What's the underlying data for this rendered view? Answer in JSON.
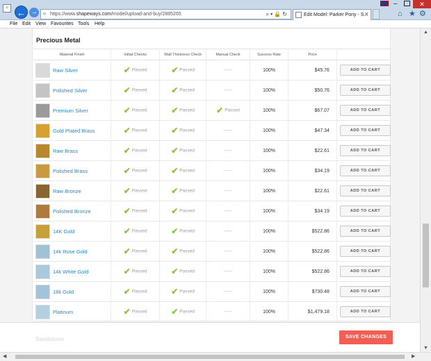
{
  "browser": {
    "url_prefix": "https://www.",
    "url_domain": "shapeways.com",
    "url_path": "/model/upload-and-buy/2885265",
    "tab_title": "Edit Model: Parker Pony - S...",
    "menu": [
      "File",
      "Edit",
      "View",
      "Favourites",
      "Tools",
      "Help"
    ]
  },
  "section": {
    "title": "Precious Metal",
    "columns": [
      "Material Finish",
      "Initial Checks",
      "Wall Thickness Check",
      "Manual Check",
      "Success Rate",
      "Price",
      ""
    ]
  },
  "rows": [
    {
      "name": "Raw Silver",
      "thumb_color": "#d9d9d9",
      "initial": "Passed",
      "wall": "Passed",
      "manual": "-----",
      "manual_passed": false,
      "rate": "100%",
      "price": "$45.76",
      "button": "ADD TO CART"
    },
    {
      "name": "Polished Silver",
      "thumb_color": "#c4c4c4",
      "initial": "Passed",
      "wall": "Passed",
      "manual": "-----",
      "manual_passed": false,
      "rate": "100%",
      "price": "$50.76",
      "button": "ADD TO CART"
    },
    {
      "name": "Premium Silver",
      "thumb_color": "#9a9a9a",
      "initial": "Passed",
      "wall": "Passed",
      "manual": "Passed",
      "manual_passed": true,
      "rate": "100%",
      "price": "$67.07",
      "button": "ADD TO CART"
    },
    {
      "name": "Gold Plated Brass",
      "thumb_color": "#d6a12e",
      "initial": "Passed",
      "wall": "Passed",
      "manual": "-----",
      "manual_passed": false,
      "rate": "100%",
      "price": "$47.34",
      "button": "ADD TO CART"
    },
    {
      "name": "Raw Brass",
      "thumb_color": "#b8892c",
      "initial": "Passed",
      "wall": "Passed",
      "manual": "-----",
      "manual_passed": false,
      "rate": "100%",
      "price": "$22.61",
      "button": "ADD TO CART"
    },
    {
      "name": "Polished Brass",
      "thumb_color": "#c99a3f",
      "initial": "Passed",
      "wall": "Passed",
      "manual": "-----",
      "manual_passed": false,
      "rate": "100%",
      "price": "$34.19",
      "button": "ADD TO CART"
    },
    {
      "name": "Raw Bronze",
      "thumb_color": "#8a6530",
      "initial": "Passed",
      "wall": "Passed",
      "manual": "-----",
      "manual_passed": false,
      "rate": "100%",
      "price": "$22.61",
      "button": "ADD TO CART"
    },
    {
      "name": "Polished Bronze",
      "thumb_color": "#b07a3a",
      "initial": "Passed",
      "wall": "Passed",
      "manual": "-----",
      "manual_passed": false,
      "rate": "100%",
      "price": "$34.19",
      "button": "ADD TO CART"
    },
    {
      "name": "14K Gold",
      "thumb_color": "#c8a03a",
      "initial": "Passed",
      "wall": "Passed",
      "manual": "-----",
      "manual_passed": false,
      "rate": "100%",
      "price": "$522.86",
      "button": "ADD TO CART"
    },
    {
      "name": "14k Rose Gold",
      "thumb_color": "#9fc2d6",
      "initial": "Passed",
      "wall": "Passed",
      "manual": "-----",
      "manual_passed": false,
      "rate": "100%",
      "price": "$522.86",
      "button": "ADD TO CART"
    },
    {
      "name": "14k White Gold",
      "thumb_color": "#a9c9dc",
      "initial": "Passed",
      "wall": "Passed",
      "manual": "-----",
      "manual_passed": false,
      "rate": "100%",
      "price": "$522.86",
      "button": "ADD TO CART"
    },
    {
      "name": "18k Gold",
      "thumb_color": "#a3c4d8",
      "initial": "Passed",
      "wall": "Passed",
      "manual": "-----",
      "manual_passed": false,
      "rate": "100%",
      "price": "$730.48",
      "button": "ADD TO CART"
    },
    {
      "name": "Platinum",
      "thumb_color": "#b4cfdf",
      "initial": "Passed",
      "wall": "Passed",
      "manual": "-----",
      "manual_passed": false,
      "rate": "100%",
      "price": "$1,479.18",
      "button": "ADD TO CART"
    }
  ],
  "footer": {
    "faded_label": "Sandstone",
    "save_label": "SAVE CHANGES"
  },
  "colors": {
    "accent_link": "#2a86c2",
    "check_green": "#8cc63f",
    "save_button": "#f25e54"
  }
}
